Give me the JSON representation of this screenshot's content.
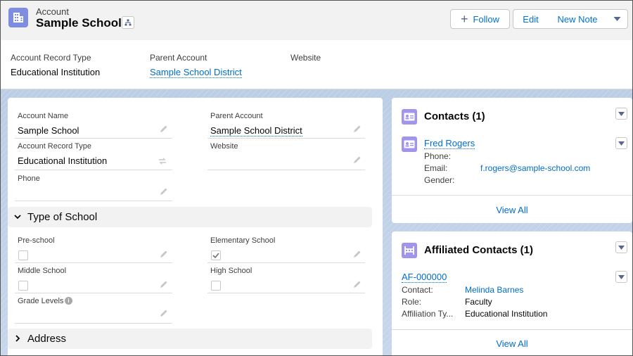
{
  "header": {
    "object_type": "Account",
    "record_name": "Sample School",
    "follow_label": "Follow",
    "edit_label": "Edit",
    "new_note_label": "New Note",
    "highlights": [
      {
        "label": "Account Record Type",
        "value": "Educational Institution"
      },
      {
        "label": "Parent Account",
        "value": "Sample School District"
      },
      {
        "label": "Website",
        "value": ""
      }
    ]
  },
  "detail": {
    "fields": {
      "account_name": {
        "label": "Account Name",
        "value": "Sample School"
      },
      "parent_account": {
        "label": "Parent Account",
        "value": "Sample School District"
      },
      "record_type": {
        "label": "Account Record Type",
        "value": "Educational Institution"
      },
      "website": {
        "label": "Website",
        "value": ""
      },
      "phone": {
        "label": "Phone",
        "value": ""
      }
    },
    "section_type": "Type of School",
    "school_types": {
      "preschool": {
        "label": "Pre-school",
        "checked": false
      },
      "elementary": {
        "label": "Elementary School",
        "checked": true
      },
      "middle": {
        "label": "Middle School",
        "checked": false
      },
      "high": {
        "label": "High School",
        "checked": false
      }
    },
    "grade_levels_label": "Grade Levels",
    "section_address": "Address"
  },
  "contacts": {
    "title": "Contacts (1)",
    "contact_name": "Fred Rogers",
    "phone_label": "Phone:",
    "email_label": "Email:",
    "email_value": "f.rogers@sample-school.com",
    "gender_label": "Gender:",
    "view_all": "View All"
  },
  "affiliated": {
    "title": "Affiliated Contacts (1)",
    "record_id": "AF-000000",
    "contact_label": "Contact:",
    "contact_value": "Melinda Barnes",
    "role_label": "Role:",
    "role_value": "Faculty",
    "aff_type_label": "Affiliation Ty...",
    "aff_type_value": "Educational Institution",
    "view_all": "View All"
  },
  "colors": {
    "brand_blue": "#0070d2",
    "account_icon": "#7f8de1",
    "contact_icon": "#a094ed"
  }
}
